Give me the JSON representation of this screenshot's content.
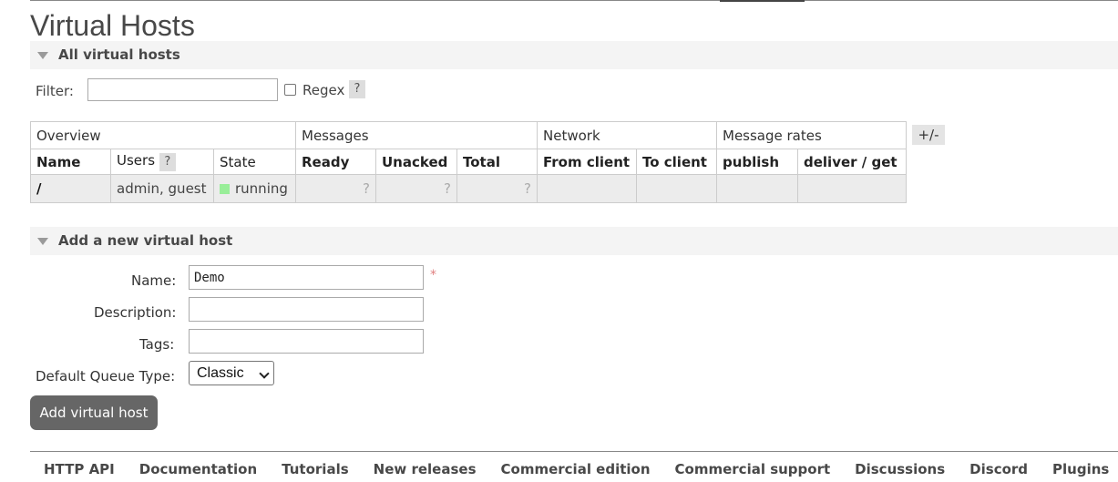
{
  "page": {
    "title": "Virtual Hosts"
  },
  "all_vhosts": {
    "header": "All virtual hosts",
    "filter_label": "Filter:",
    "filter_value": "",
    "regex_label": "Regex",
    "help_mark": "?",
    "column_groups": [
      "Overview",
      "Messages",
      "Network",
      "Message rates"
    ],
    "columns": [
      "Name",
      "Users",
      "State",
      "Ready",
      "Unacked",
      "Total",
      "From client",
      "To client",
      "publish",
      "deliver / get"
    ],
    "rows": [
      {
        "name": "/",
        "users": "admin, guest",
        "state": "running",
        "ready": "?",
        "unacked": "?",
        "total": "?",
        "from_client": "",
        "to_client": "",
        "publish": "",
        "deliver_get": ""
      }
    ],
    "columns_toggle": "+/-",
    "colors": {
      "running_indicator": "#99ee99"
    }
  },
  "add_vhost": {
    "header": "Add a new virtual host",
    "name_label": "Name:",
    "name_value": "Demo",
    "required_mark": "*",
    "description_label": "Description:",
    "description_value": "",
    "tags_label": "Tags:",
    "tags_value": "",
    "queue_type_label": "Default Queue Type:",
    "queue_type_value": "Classic",
    "submit_label": "Add virtual host"
  },
  "footer": {
    "links": [
      "HTTP API",
      "Documentation",
      "Tutorials",
      "New releases",
      "Commercial edition",
      "Commercial support",
      "Discussions",
      "Discord",
      "Plugins"
    ]
  }
}
